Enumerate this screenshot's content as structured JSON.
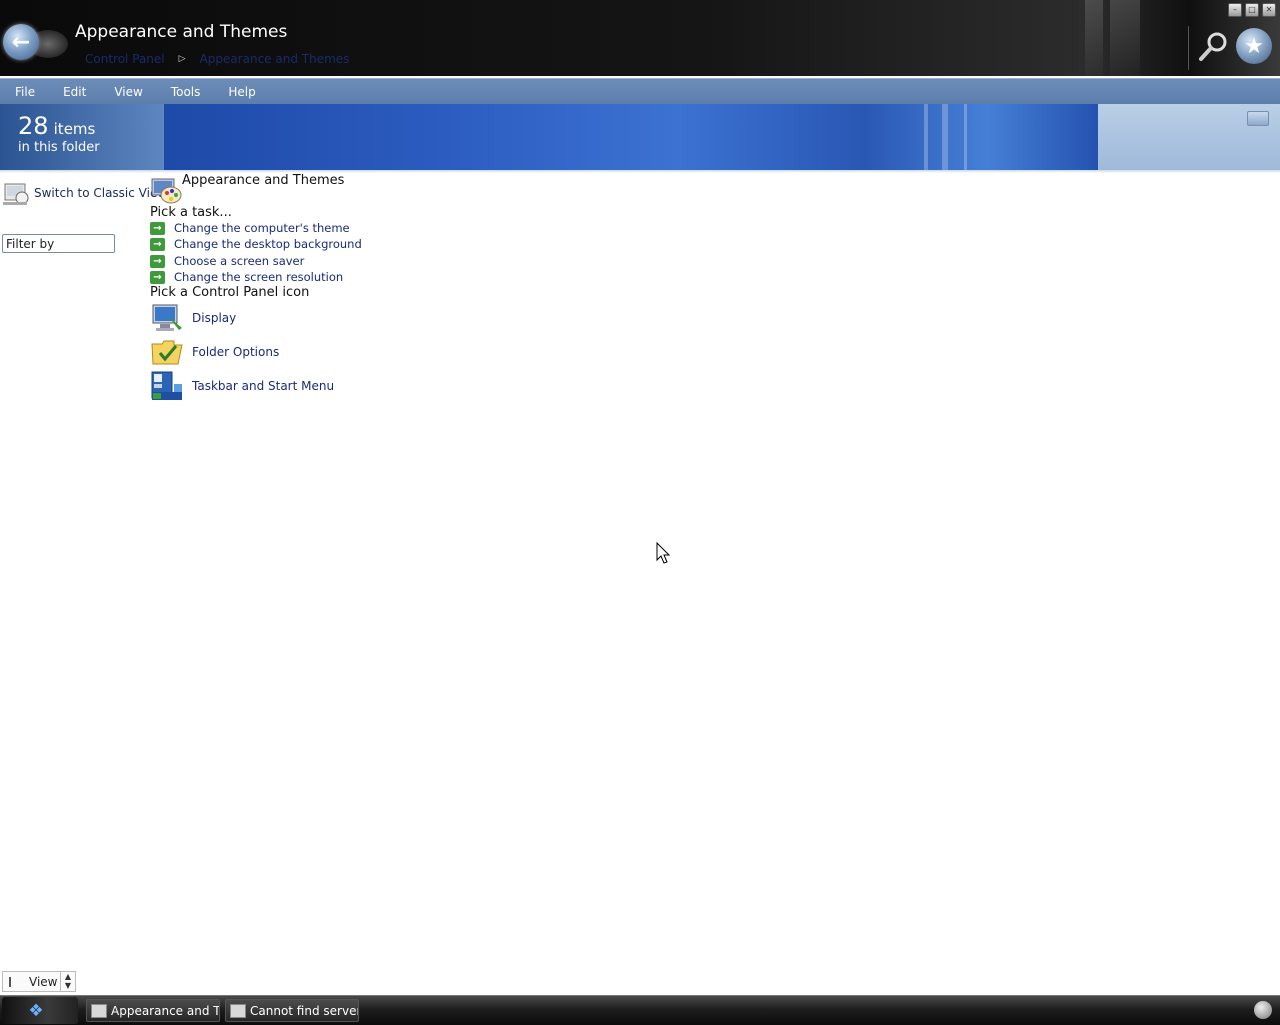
{
  "window": {
    "title": "Appearance and Themes",
    "breadcrumb": [
      "Control Panel",
      "Appearance and Themes"
    ],
    "controls": [
      "minimize",
      "maximize",
      "close"
    ]
  },
  "menu": [
    "File",
    "Edit",
    "View",
    "Tools",
    "Help"
  ],
  "header": {
    "count": "28",
    "count_unit": "items",
    "subtitle": "in this folder"
  },
  "sidebar": {
    "classic_view": "Switch to Classic View",
    "filter_placeholder": "Filter by"
  },
  "main": {
    "title": "Appearance and Themes",
    "task_heading": "Pick a task...",
    "tasks": [
      "Change the computer's theme",
      "Change the desktop background",
      "Choose a screen saver",
      "Change the screen resolution"
    ],
    "icon_heading": "Pick a Control Panel icon",
    "icons": [
      {
        "label": "Display",
        "icon": "display-icon"
      },
      {
        "label": "Folder Options",
        "icon": "folder-options-icon"
      },
      {
        "label": "Taskbar and Start Menu",
        "icon": "taskbar-icon"
      }
    ]
  },
  "statusbar": {
    "view_label": "View"
  },
  "taskbar": {
    "buttons": [
      "Appearance and T...",
      "Cannot find server"
    ]
  },
  "colors": {
    "menu_bar": "#6d8db8",
    "banner": "#2c5cc0",
    "link": "#1a2a7a",
    "task_arrow": "#3f9a3c"
  }
}
